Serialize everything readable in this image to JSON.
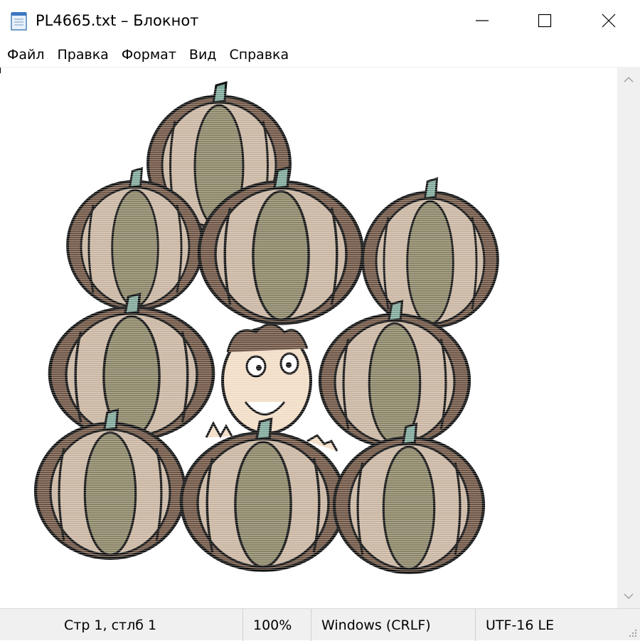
{
  "window": {
    "title": "PL4665.txt – Блокнот",
    "icon": "notepad-icon"
  },
  "controls": {
    "minimize_icon": "minimize-icon",
    "maximize_icon": "maximize-icon",
    "close_icon": "close-icon"
  },
  "menu": [
    {
      "label": "Файл"
    },
    {
      "label": "Правка"
    },
    {
      "label": "Формат"
    },
    {
      "label": "Вид"
    },
    {
      "label": "Справка"
    }
  ],
  "editor": {
    "content": "ASCII-art rendering of a pile of pumpkins with a smiling child peeking out"
  },
  "status": {
    "position": "Стр 1, стлб 1",
    "zoom": "100%",
    "line_ending": "Windows (CRLF)",
    "encoding": "UTF-16 LE"
  },
  "colors": {
    "pumpkin_dark": "#6e5443",
    "pumpkin_light": "#c8b4a0",
    "pumpkin_olive": "#8a8466",
    "stem": "#7fa89a",
    "skin": "#f1dcc4"
  }
}
